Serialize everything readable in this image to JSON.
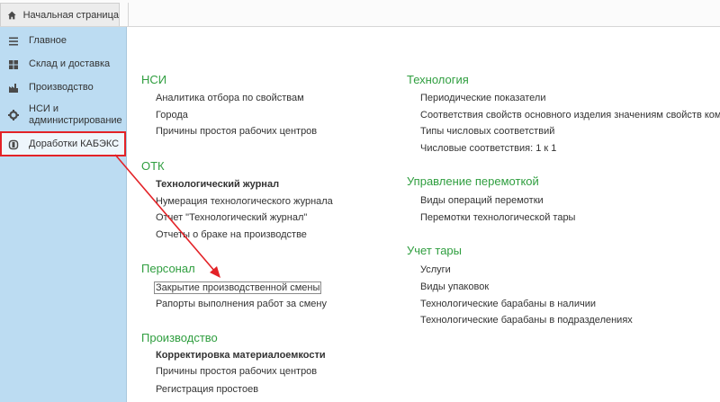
{
  "tabs": {
    "home_label": "Начальная страница"
  },
  "sidebar": {
    "items": [
      {
        "label": "Главное",
        "icon": "menu-lines-icon"
      },
      {
        "label": "Склад и доставка",
        "icon": "warehouse-grid-icon"
      },
      {
        "label": "Производство",
        "icon": "factory-icon"
      },
      {
        "label": "НСИ и администрирование",
        "icon": "gear-icon"
      },
      {
        "label": "Доработки КАБЭКС",
        "icon": "extension-icon"
      }
    ],
    "selected": "Доработки КАБЭКС"
  },
  "main": {
    "col1": {
      "nsi": {
        "title": "НСИ",
        "items": [
          "Аналитика отбора по свойствам",
          "Города",
          "Причины простоя рабочих центров"
        ]
      },
      "otk": {
        "title": "ОТК",
        "items": [
          "Технологический журнал",
          "Нумерация технологического журнала",
          "Отчет \"Технологический журнал\"",
          "Отчеты о браке на производстве"
        ]
      },
      "personal": {
        "title": "Персонал",
        "items": [
          "Закрытие производственной смены",
          "Рапорты выполнения работ за смену"
        ]
      },
      "production": {
        "title": "Производство",
        "items": [
          "Корректировка материалоемкости",
          "Причины простоя рабочих центров",
          "Регистрация простоев"
        ]
      }
    },
    "col2": {
      "technology": {
        "title": "Технология",
        "items": [
          "Периодические показатели",
          "Соответствия свойств основного изделия значениям свойств компле",
          "Типы числовых соответствий",
          "Числовые соответствия: 1 к 1"
        ]
      },
      "rewind": {
        "title": "Управление перемоткой",
        "items": [
          "Виды операций перемотки",
          "Перемотки технологической тары"
        ]
      },
      "tare": {
        "title": "Учет тары",
        "items": [
          "Услуги",
          "Виды упаковок",
          "Технологические барабаны в наличии",
          "Технологические барабаны в подразделениях"
        ]
      }
    }
  },
  "colors": {
    "sidebar_bg": "#bcdcf2",
    "group_title": "#2f9e3f",
    "highlight": "#e32227"
  }
}
